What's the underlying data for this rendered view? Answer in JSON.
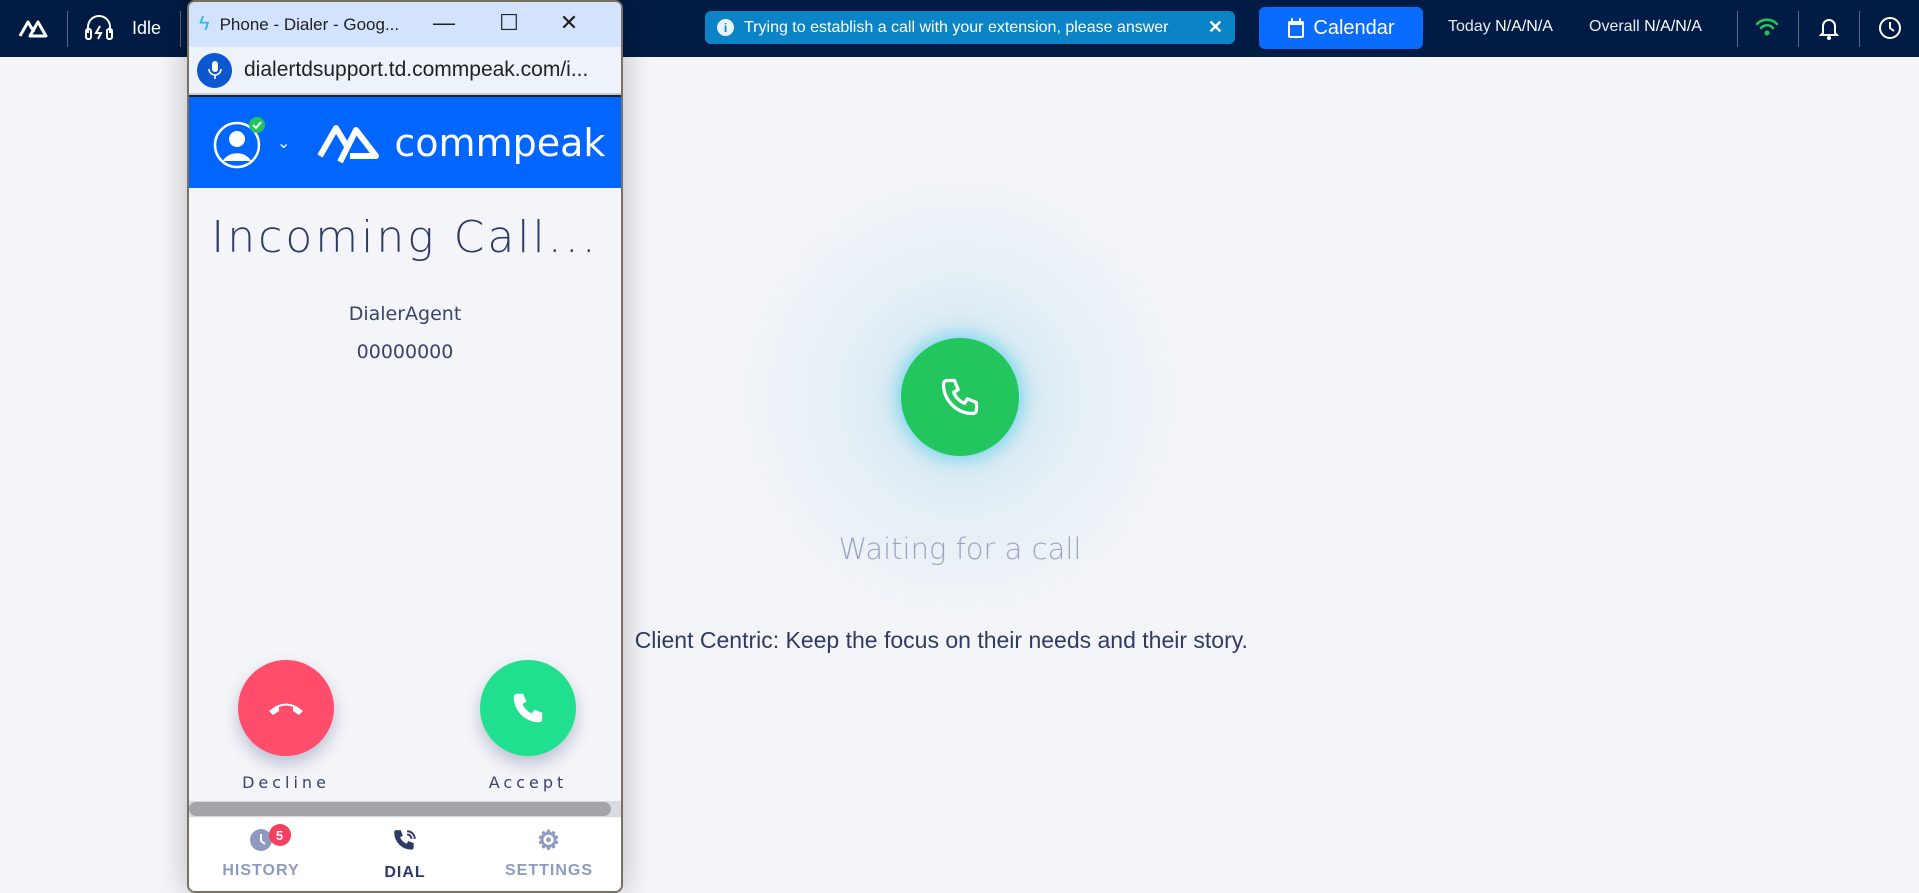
{
  "topbar": {
    "status": "Idle",
    "notification": "Trying to establish a call with your extension, please answer",
    "calendar_label": "Calendar",
    "today_label": "Today",
    "today_value": "N/A/N/A",
    "overall_label": "Overall",
    "overall_value": "N/A/N/A"
  },
  "main": {
    "waiting": "Waiting for a call",
    "quote": "Client Centric: Keep the focus on their needs and their story."
  },
  "popup": {
    "window_title": "Phone - Dialer - Goog...",
    "url": "dialertdsupport.td.commpeak.com/i...",
    "brand": "commpeak",
    "heading": "Incoming Call...",
    "caller_name": "DialerAgent",
    "caller_number": "00000000",
    "decline_label": "Decline",
    "accept_label": "Accept",
    "nav": [
      {
        "label": "HISTORY",
        "badge": "5"
      },
      {
        "label": "DIAL"
      },
      {
        "label": "SETTINGS"
      }
    ]
  },
  "colors": {
    "topbar": "#001b44",
    "brand": "#0066ff",
    "accept": "#20e08f",
    "decline": "#ff4d6b",
    "main_call": "#22c55e"
  }
}
